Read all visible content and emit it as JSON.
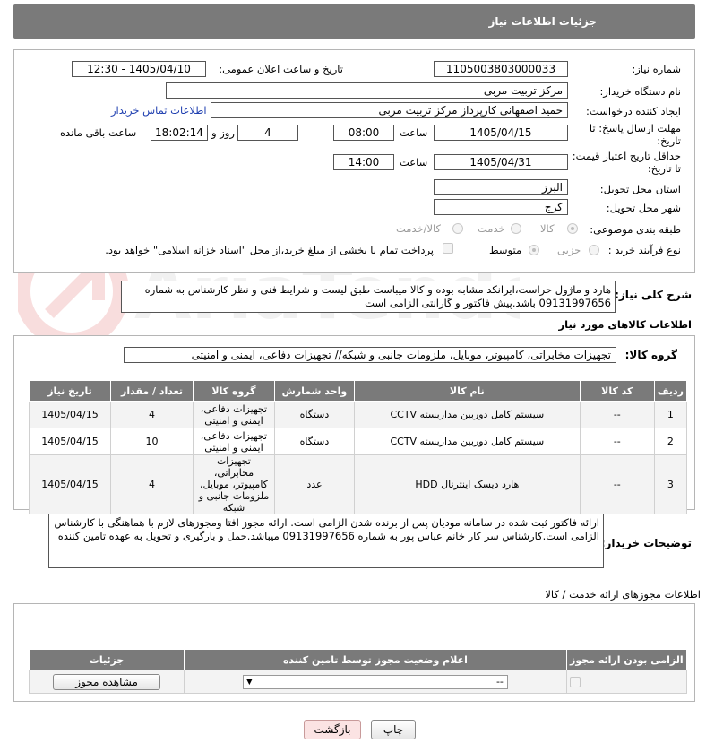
{
  "header": {
    "title": "جزئیات اطلاعات نیاز"
  },
  "form": {
    "need_number_label": "شماره نیاز:",
    "need_number": "1105003803000033",
    "announce_label": "تاریخ و ساعت اعلان عمومی:",
    "announce_value": "1405/04/10 - 12:30",
    "buyer_org_label": "نام دستگاه خریدار:",
    "buyer_org": "مرکز تربیت مربی",
    "requester_label": "ایجاد کننده درخواست:",
    "requester": "حمید اصفهانی کارپرداز مرکز تربیت مربی",
    "contact_link": "اطلاعات تماس خریدار",
    "deadline_label_1": "مهلت ارسال پاسخ: تا",
    "deadline_label_2": "تاریخ:",
    "deadline_date": "1405/04/15",
    "time_label": "ساعت",
    "deadline_time": "08:00",
    "days_value": "4",
    "days_label": "روز و",
    "remaining_time": "18:02:14",
    "remaining_label": "ساعت باقی مانده",
    "validity_label_1": "حداقل تاریخ اعتبار قیمت:",
    "validity_label_2": "تا تاریخ:",
    "validity_date": "1405/04/31",
    "validity_time": "14:00",
    "province_label": "استان محل تحویل:",
    "province": "البرز",
    "city_label": "شهر محل تحویل:",
    "city": "کرج",
    "category_label": "طبقه بندی موضوعی:",
    "category_options": [
      "کالا",
      "خدمت",
      "کالا/خدمت"
    ],
    "process_label": "نوع فرآیند خرید :",
    "process_options": [
      "جزیی",
      "متوسط"
    ],
    "payment_note": "پرداخت تمام یا بخشی از مبلغ خرید،از محل \"اسناد خزانه اسلامی\" خواهد بود."
  },
  "description": {
    "label": "شرح کلی نیاز:",
    "text": "هارد و ماژول حراست،ایرانکد مشابه بوده  و کالا میباست طبق لیست و شرایط فنی و نظر کارشناس به شماره 09131997656 باشد.پیش فاکتور و گارانتی الزامی است"
  },
  "goods_section": {
    "title": "اطلاعات کالاهای مورد نیاز",
    "group_label": "گروه کالا:",
    "group_value": "تجهیزات مخابراتی، کامپیوتر، موبایل، ملزومات جانبی و شبکه// تجهیزات دفاعی، ایمنی و امنیتی"
  },
  "items_table": {
    "headers": [
      "ردیف",
      "کد کالا",
      "نام کالا",
      "واحد شمارش",
      "گروه کالا",
      "تعداد / مقدار",
      "تاریخ نیاز"
    ],
    "rows": [
      {
        "row": "1",
        "code": "--",
        "name": "سیستم کامل دوربین مداربسته CCTV",
        "unit": "دستگاه",
        "group": "تجهیزات دفاعی، ایمنی و امنیتی",
        "qty": "4",
        "date": "1405/04/15"
      },
      {
        "row": "2",
        "code": "--",
        "name": "سیستم کامل دوربین مداربسته CCTV",
        "unit": "دستگاه",
        "group": "تجهیزات دفاعی، ایمنی و امنیتی",
        "qty": "10",
        "date": "1405/04/15"
      },
      {
        "row": "3",
        "code": "--",
        "name": "هارد دیسک اینترنال HDD",
        "unit": "عدد",
        "group": "تجهیزات مخابراتی، کامپیوتر، موبایل، ملزومات جانبی و شبکه",
        "qty": "4",
        "date": "1405/04/15"
      }
    ]
  },
  "buyer_notes": {
    "label": "توضیحات خریدار:",
    "text": "ارائه فاکتور ثبت شده در سامانه مودیان پس از برنده شدن الزامی است. ارائه مجوز افتا ومجوزهای لازم با هماهنگی با کارشناس الزامی است.کارشناس سر کار خانم عباس پور به شماره 09131997656 میباشد.حمل و بارگیری و تحویل به عهده تامین کننده"
  },
  "licenses": {
    "title": "اطلاعات مجوزهای ارائه خدمت / کالا",
    "headers": [
      "الزامی بودن ارائه مجوز",
      "اعلام وضعیت مجوز توسط تامین کننده",
      "جزئیات"
    ],
    "select_value": "--",
    "view_button": "مشاهده مجوز"
  },
  "buttons": {
    "print": "چاپ",
    "back": "بازگشت"
  },
  "watermark_text": "AriaTender.net"
}
